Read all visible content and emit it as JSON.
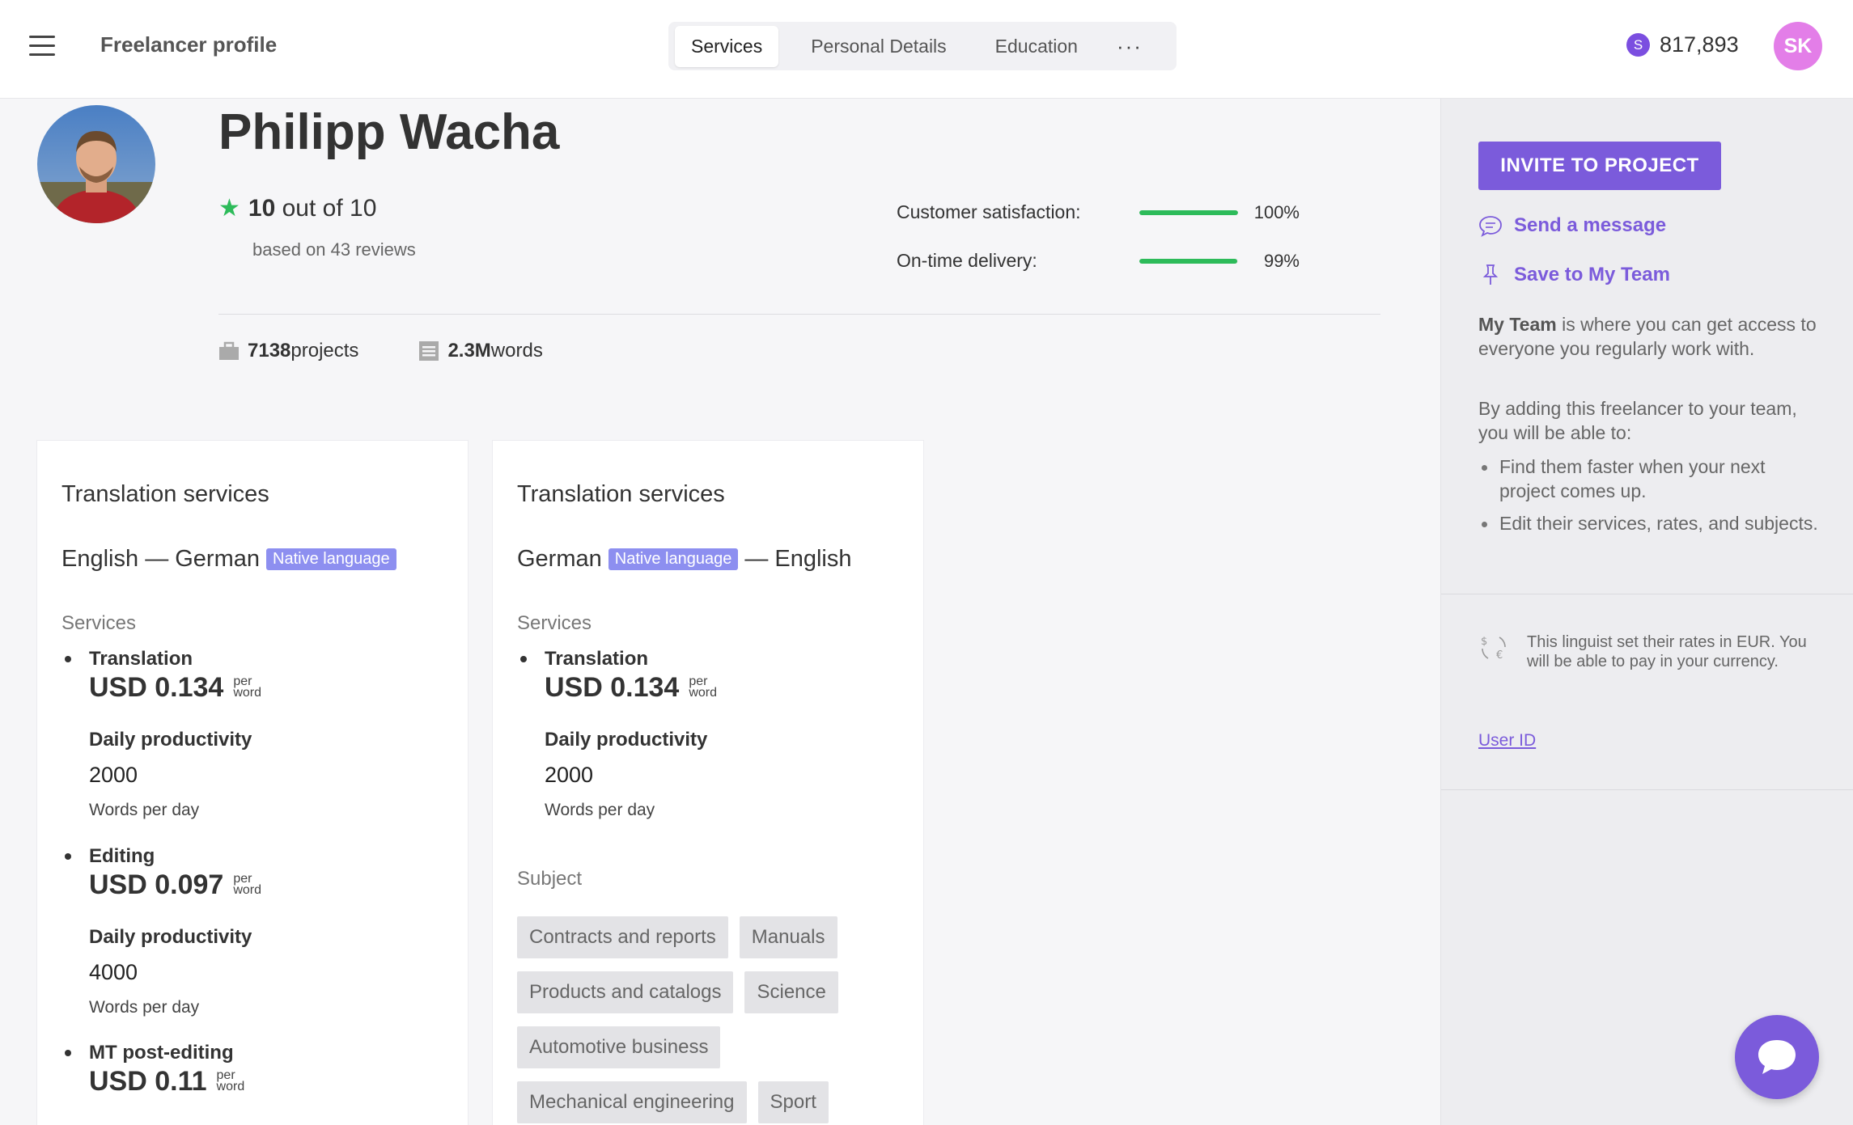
{
  "header": {
    "app_title": "Freelancer profile",
    "tabs": [
      {
        "label": "Services",
        "active": true
      },
      {
        "label": "Personal Details",
        "active": false
      },
      {
        "label": "Education",
        "active": false
      }
    ],
    "more_label": "···",
    "balance_symbol": "S",
    "balance": "817,893",
    "user_initials": "SK"
  },
  "profile": {
    "name": "Philipp Wacha",
    "rating_score": "10",
    "rating_suffix": " out of 10",
    "reviews": "based on 43 reviews",
    "metrics": [
      {
        "label": "Customer satisfaction:",
        "value": "100%",
        "fraction": 1.0
      },
      {
        "label": "On-time delivery:",
        "value": "99%",
        "fraction": 0.99
      }
    ],
    "projects_count": "7138",
    "projects_label": "projects",
    "words_count": "2.3M",
    "words_label": " words"
  },
  "cards": [
    {
      "title": "Translation services",
      "source": "English",
      "dash": "—",
      "target": "German",
      "native_badge": "Native language",
      "services_heading": "Services",
      "services": [
        {
          "name": "Translation",
          "price": "USD 0.134",
          "per1": "per",
          "per2": "word",
          "dp_label": "Daily productivity",
          "dp_value": "2000",
          "dp_unit": "Words per day"
        },
        {
          "name": "Editing",
          "price": "USD 0.097",
          "per1": "per",
          "per2": "word",
          "dp_label": "Daily productivity",
          "dp_value": "4000",
          "dp_unit": "Words per day"
        },
        {
          "name": "MT post-editing",
          "price": "USD 0.11",
          "per1": "per",
          "per2": "word"
        }
      ]
    },
    {
      "title": "Translation services",
      "source": "German",
      "dash": "—",
      "target": "English",
      "native_badge": "Native language",
      "services_heading": "Services",
      "services": [
        {
          "name": "Translation",
          "price": "USD 0.134",
          "per1": "per",
          "per2": "word",
          "dp_label": "Daily productivity",
          "dp_value": "2000",
          "dp_unit": "Words per day"
        }
      ],
      "subject_heading": "Subject",
      "subjects": [
        "Contracts and reports",
        "Manuals",
        "Products and catalogs",
        "Science",
        "Automotive business",
        "Mechanical engineering",
        "Sport"
      ]
    }
  ],
  "sidebar": {
    "invite_label": "INVITE TO PROJECT",
    "send_message": "Send a message",
    "save_team": "Save to My Team",
    "myteam_bold": "My Team",
    "myteam_text": " is where you can get access to everyone you regularly work with.",
    "adding_text": "By adding this freelancer to your team, you will be able to:",
    "benefits": [
      "Find them faster when your next project comes up.",
      "Edit their services, rates, and subjects."
    ],
    "currency_note": "This linguist set their rates in EUR. You will be able to pay in your currency.",
    "user_id": "User ID"
  },
  "colors": {
    "accent": "#7b5bdb",
    "success": "#2dbb5a",
    "badge": "#8d8ff0",
    "avatar": "#e37ee8"
  }
}
